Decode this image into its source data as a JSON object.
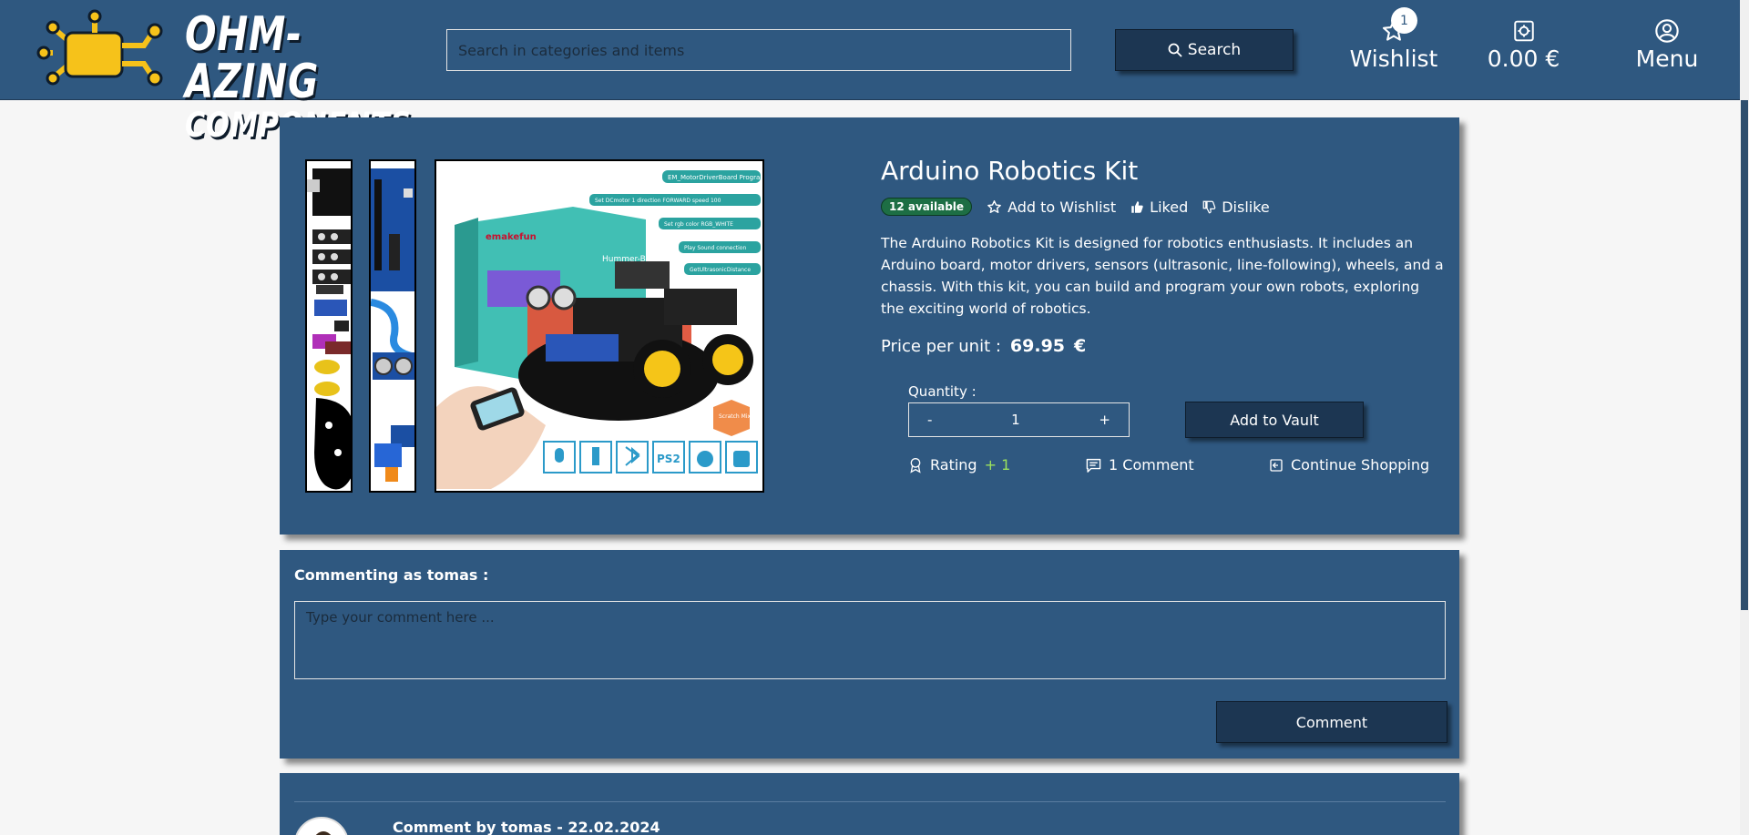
{
  "header": {
    "logo_line1": "OHM-AZING",
    "logo_line2": "COMPONENTS",
    "search_placeholder": "Search in categories and items",
    "search_button": "Search",
    "wishlist_label": "Wishlist",
    "wishlist_count": "1",
    "cart_total": "0.00 €",
    "menu_label": "Menu"
  },
  "product": {
    "title": "Arduino Robotics Kit",
    "availability": "12 available",
    "add_to_wishlist": "Add to Wishlist",
    "liked": "Liked",
    "dislike": "Dislike",
    "description": "The Arduino Robotics Kit is designed for robotics enthusiasts. It includes an Arduino board, motor drivers, sensors (ultrasonic, line-following), wheels, and a chassis. With this kit, you can build and program your own robots, exploring the exciting world of robotics.",
    "price_label": "Price per unit :",
    "price_value": "69.95",
    "currency": "€",
    "quantity_label": "Quantity :",
    "quantity_minus": "-",
    "quantity_value": "1",
    "quantity_plus": "+",
    "add_to_vault": "Add to Vault",
    "rating_label": "Rating",
    "rating_value": "+ 1",
    "comments_count": "1 Comment",
    "continue_shopping": "Continue Shopping"
  },
  "box_art": {
    "brand": "emakefun",
    "product": "Hummer-Bot",
    "code_blocks": [
      "EM_MotorDriverBoard Program",
      "Set DCmotor 1 direction FORWARD speed 100",
      "Set rgb color RGB_WHITE",
      "Play Sound connection",
      "GetUltrasonicDistance"
    ],
    "badge": "Scratch Mixly",
    "ps2": "PS2"
  },
  "comment_form": {
    "commenting_as": "Commenting as tomas :",
    "placeholder": "Type your comment here ...",
    "submit": "Comment"
  },
  "comments": [
    {
      "header": "Comment by tomas - 22.02.2024"
    }
  ],
  "colors": {
    "header_bg": "#2f5880",
    "panel_bg": "#2f5880",
    "button_bg": "#1c3652",
    "available_badge": "#1d6e44",
    "rating_plus": "#9be15d",
    "logo_yellow": "#f6c21a"
  }
}
